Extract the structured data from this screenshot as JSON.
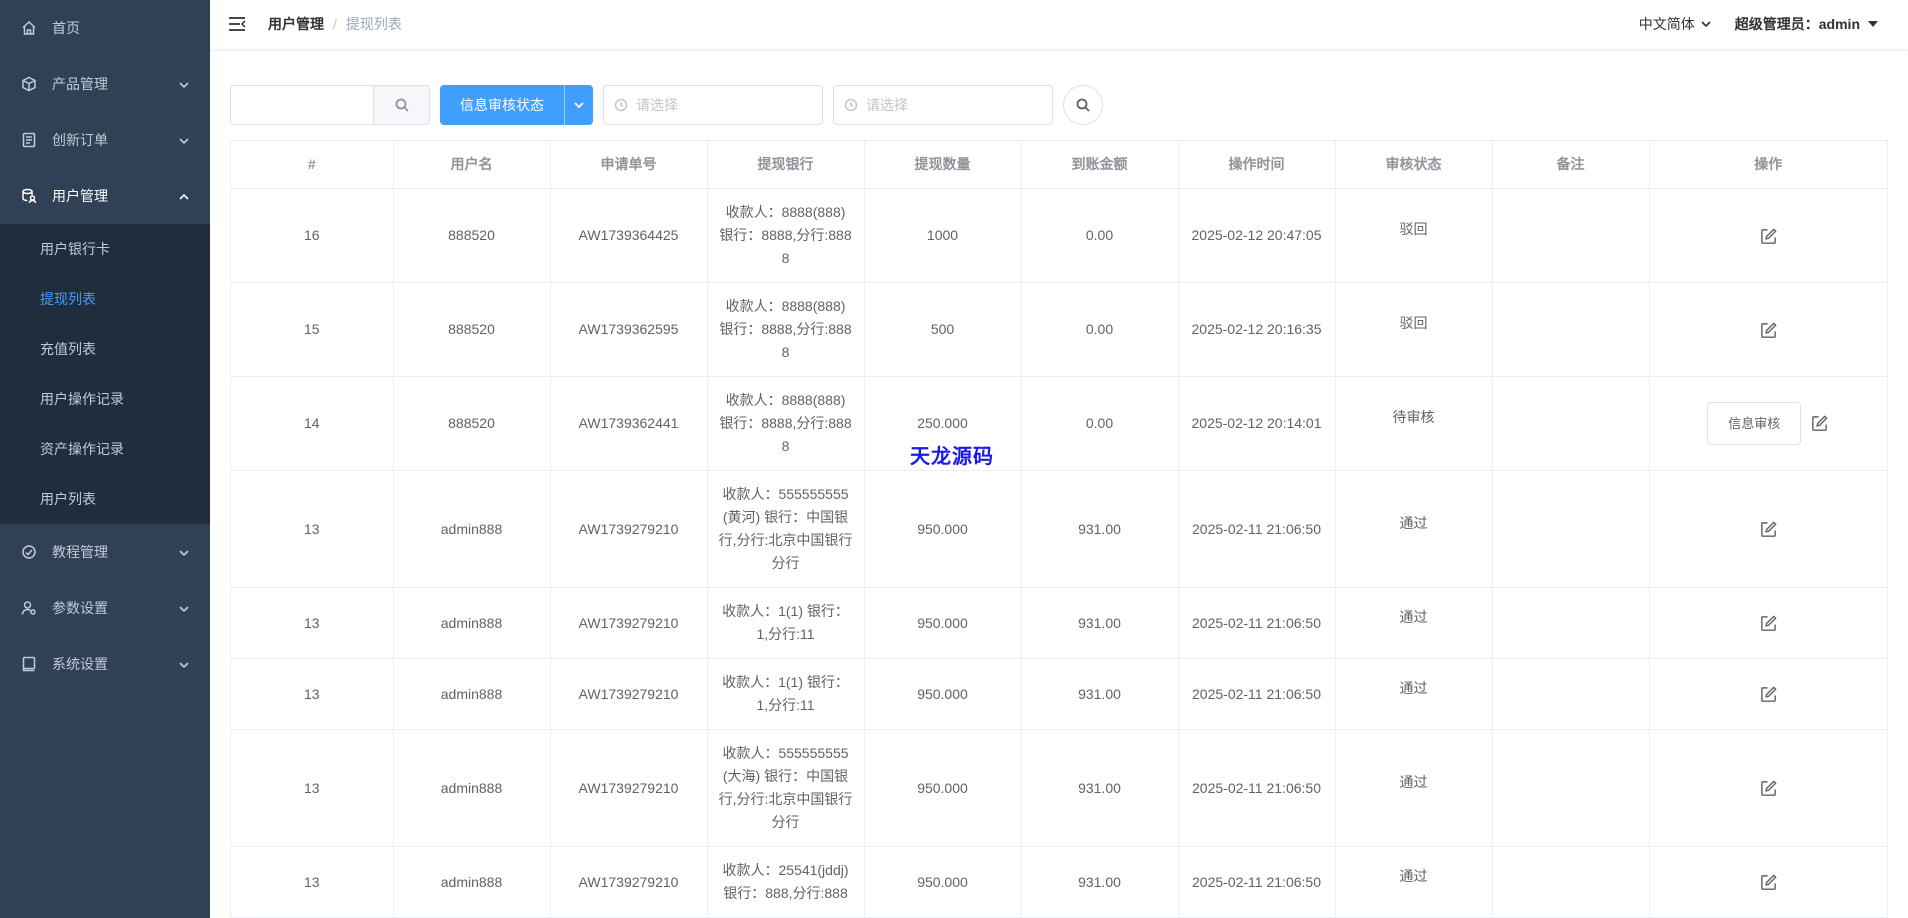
{
  "sidebar": {
    "items": [
      {
        "label": "首页",
        "icon": "home-icon"
      },
      {
        "label": "产品管理",
        "icon": "box-icon"
      },
      {
        "label": "创新订单",
        "icon": "list-icon"
      },
      {
        "label": "用户管理",
        "icon": "user-db-icon"
      }
    ],
    "submenu": [
      {
        "label": "用户银行卡"
      },
      {
        "label": "提现列表"
      },
      {
        "label": "充值列表"
      },
      {
        "label": "用户操作记录"
      },
      {
        "label": "资产操作记录"
      },
      {
        "label": "用户列表"
      }
    ],
    "items_after": [
      {
        "label": "教程管理",
        "icon": "check-circle-icon"
      },
      {
        "label": "参数设置",
        "icon": "user-gear-icon"
      },
      {
        "label": "系统设置",
        "icon": "book-icon"
      }
    ]
  },
  "navbar": {
    "breadcrumb_1": "用户管理",
    "breadcrumb_sep": "/",
    "breadcrumb_2": "提现列表",
    "language": "中文简体",
    "admin": "超级管理员：admin"
  },
  "filters": {
    "search_value": "",
    "status_button": "信息审核状态",
    "date_start_placeholder": "请选择",
    "date_end_placeholder": "请选择"
  },
  "table": {
    "headers": [
      "#",
      "用户名",
      "申请单号",
      "提现银行",
      "提现数量",
      "到账金额",
      "操作时间",
      "审核状态",
      "备注",
      "操作"
    ],
    "rows": [
      {
        "id": "16",
        "user": "888520",
        "order": "AW1739364425",
        "bank": "收款人：8888(888) 银行：8888,分行:8888",
        "amount": "1000",
        "received": "0.00",
        "time": "2025-02-12 20:47:05",
        "status": "驳回",
        "note": "",
        "review_btn": ""
      },
      {
        "id": "15",
        "user": "888520",
        "order": "AW1739362595",
        "bank": "收款人：8888(888) 银行：8888,分行:8888",
        "amount": "500",
        "received": "0.00",
        "time": "2025-02-12 20:16:35",
        "status": "驳回",
        "note": "",
        "review_btn": ""
      },
      {
        "id": "14",
        "user": "888520",
        "order": "AW1739362441",
        "bank": "收款人：8888(888) 银行：8888,分行:8888",
        "amount": "250.000",
        "received": "0.00",
        "time": "2025-02-12 20:14:01",
        "status": "待审核",
        "note": "",
        "review_btn": "信息审核"
      },
      {
        "id": "13",
        "user": "admin888",
        "order": "AW1739279210",
        "bank": "收款人：555555555(黄河) 银行：中国银行,分行:北京中国银行分行",
        "amount": "950.000",
        "received": "931.00",
        "time": "2025-02-11 21:06:50",
        "status": "通过",
        "note": "",
        "review_btn": ""
      },
      {
        "id": "13",
        "user": "admin888",
        "order": "AW1739279210",
        "bank": "收款人：1(1) 银行：1,分行:11",
        "amount": "950.000",
        "received": "931.00",
        "time": "2025-02-11 21:06:50",
        "status": "通过",
        "note": "",
        "review_btn": ""
      },
      {
        "id": "13",
        "user": "admin888",
        "order": "AW1739279210",
        "bank": "收款人：1(1) 银行：1,分行:11",
        "amount": "950.000",
        "received": "931.00",
        "time": "2025-02-11 21:06:50",
        "status": "通过",
        "note": "",
        "review_btn": ""
      },
      {
        "id": "13",
        "user": "admin888",
        "order": "AW1739279210",
        "bank": "收款人：555555555(大海) 银行：中国银行,分行:北京中国银行分行",
        "amount": "950.000",
        "received": "931.00",
        "time": "2025-02-11 21:06:50",
        "status": "通过",
        "note": "",
        "review_btn": ""
      },
      {
        "id": "13",
        "user": "admin888",
        "order": "AW1739279210",
        "bank": "收款人：25541(jddj) 银行：888,分行:888",
        "amount": "950.000",
        "received": "931.00",
        "time": "2025-02-11 21:06:50",
        "status": "通过",
        "note": "",
        "review_btn": ""
      }
    ]
  },
  "watermark": "天龙源码",
  "colors": {
    "sidebar_bg": "#304156",
    "submenu_bg": "#1f2d3d",
    "accent": "#409eff"
  }
}
